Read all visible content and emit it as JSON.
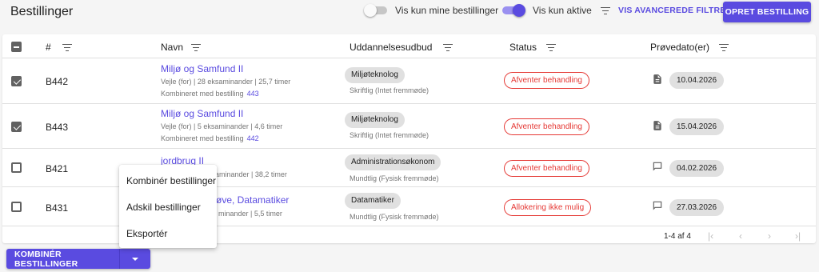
{
  "header": {
    "title": "Bestillinger",
    "toggle_mine": "Vis kun mine bestillinger",
    "toggle_active": "Vis kun aktive",
    "advanced_filters": "VIS AVANCEREDE FILTRE",
    "create_order": "OPRET BESTILLING"
  },
  "columns": {
    "number": "#",
    "name": "Navn",
    "education": "Uddannelsesudbud",
    "status": "Status",
    "exam_dates": "Prøvedato(er)"
  },
  "rows": [
    {
      "id": "B442",
      "checked": true,
      "name": "Miljø og Samfund II",
      "meta": "Vejle (for) | 28 eksaminander | 25,7 timer",
      "combined_label": "Kombineret med bestilling",
      "combined_ref": "443",
      "education": "Miljøteknolog",
      "exam_form": "Skriftlig (Intet fremmøde)",
      "status": "Afventer behandling",
      "date_icon": "document-icon",
      "date": "10.04.2026"
    },
    {
      "id": "B443",
      "checked": true,
      "name": "Miljø og Samfund II",
      "meta": "Vejle (for) | 5 eksaminander | 4,6 timer",
      "combined_label": "Kombineret med bestilling",
      "combined_ref": "442",
      "education": "Miljøteknolog",
      "exam_form": "Skriftlig (Intet fremmøde)",
      "status": "Afventer behandling",
      "date_icon": "document-icon",
      "date": "15.04.2026"
    },
    {
      "id": "B421",
      "checked": false,
      "name": "jordbrug II",
      "meta": "aminander | 38,2 timer",
      "education": "Administrationsøkonom",
      "exam_form": "Mundtlig (Fysisk fremmøde)",
      "status": "Afventer behandling",
      "date_icon": "chat-icon",
      "date": "04.02.2026"
    },
    {
      "id": "B431",
      "checked": false,
      "name": "øve, Datamatiker",
      "meta": "minander | 5,5 timer",
      "education": "Datamatiker",
      "exam_form": "Mundtlig (Fysisk fremmøde)",
      "status": "Allokering ikke mulig",
      "date_icon": "chat-icon",
      "date": "27.03.2026"
    }
  ],
  "pagination": {
    "range": "1-4 af 4"
  },
  "menu": {
    "items": [
      "Kombinér bestillinger",
      "Adskil bestillinger",
      "Eksportér"
    ]
  },
  "bulk_action": {
    "label": "KOMBINÉR BESTILLINGER"
  },
  "colors": {
    "primary": "#5a4be0",
    "status_red": "#e53935",
    "chip_grey": "#e0e0e0"
  }
}
